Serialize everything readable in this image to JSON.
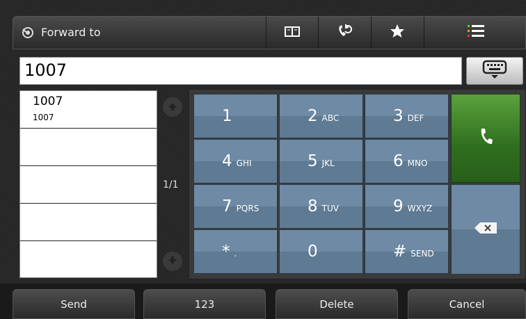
{
  "header": {
    "title": "Forward to",
    "icons": [
      "forward-icon",
      "directory-icon",
      "call-history-icon",
      "favorites-icon",
      "menu-icon"
    ]
  },
  "input": {
    "value": "1007"
  },
  "results": {
    "items": [
      {
        "name": "1007",
        "number": "1007"
      },
      {
        "name": "",
        "number": ""
      },
      {
        "name": "",
        "number": ""
      },
      {
        "name": "",
        "number": ""
      },
      {
        "name": "",
        "number": ""
      }
    ],
    "page": "1/1"
  },
  "keypad": {
    "keys": [
      {
        "digit": "1",
        "letters": ""
      },
      {
        "digit": "2",
        "letters": "ABC"
      },
      {
        "digit": "3",
        "letters": "DEF"
      },
      {
        "digit": "4",
        "letters": "GHI"
      },
      {
        "digit": "5",
        "letters": "JKL"
      },
      {
        "digit": "6",
        "letters": "MNO"
      },
      {
        "digit": "7",
        "letters": "PQRS"
      },
      {
        "digit": "8",
        "letters": "TUV"
      },
      {
        "digit": "9",
        "letters": "WXYZ"
      },
      {
        "digit": "*",
        "letters": "."
      },
      {
        "digit": "0",
        "letters": ""
      },
      {
        "digit": "#",
        "letters": "SEND"
      }
    ]
  },
  "softkeys": {
    "send": "Send",
    "mode": "123",
    "delete": "Delete",
    "cancel": "Cancel"
  },
  "colors": {
    "key": "#6e8aa4",
    "call": "#3f8a2a"
  }
}
